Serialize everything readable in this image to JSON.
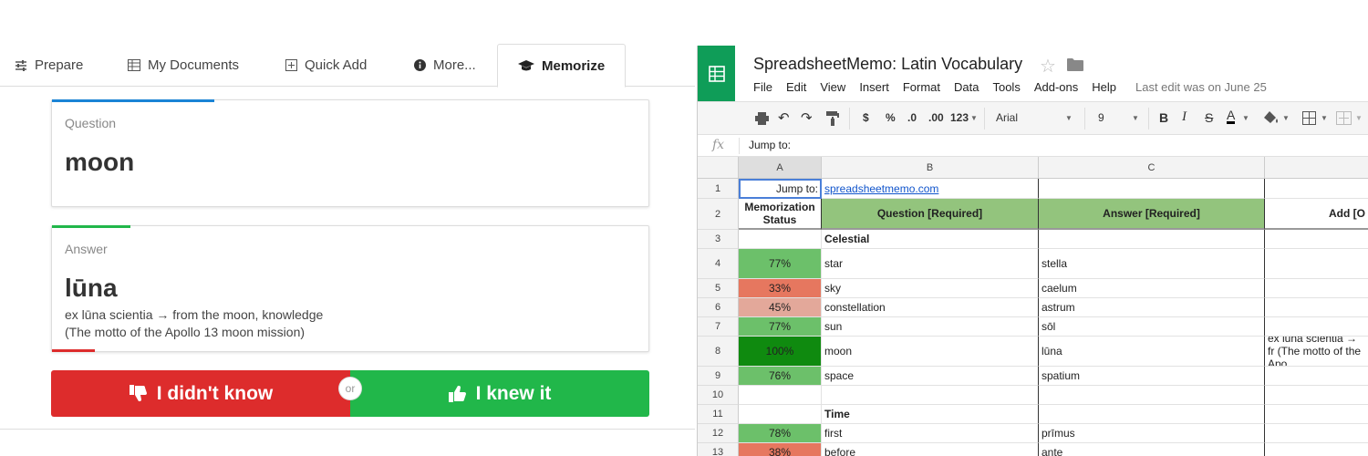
{
  "app": {
    "tabs": [
      {
        "label": "Prepare"
      },
      {
        "label": "My Documents"
      },
      {
        "label": "Quick Add"
      },
      {
        "label": "More..."
      },
      {
        "label": "Memorize"
      }
    ],
    "question": {
      "label": "Question",
      "text": "moon",
      "accent": "#1a84d6"
    },
    "answer": {
      "label": "Answer",
      "text": "lūna",
      "notes": [
        "ex lūna scientia → from the moon, knowledge",
        "(The motto of the Apollo 13 moon mission)"
      ],
      "accent": "#21b74a",
      "accent_bottom": "#dd2c2c"
    },
    "buttons": {
      "no_label": "I didn't know",
      "or_label": "or",
      "yes_label": "I knew it"
    },
    "colors": {
      "no": "#dd2c2c",
      "yes": "#21b74a"
    }
  },
  "sheet": {
    "title": "SpreadsheetMemo: Latin Vocabulary",
    "menu": [
      "File",
      "Edit",
      "View",
      "Insert",
      "Format",
      "Data",
      "Tools",
      "Add-ons",
      "Help"
    ],
    "last_edit": "Last edit was on June 25",
    "toolbar": {
      "currency": "$",
      "percent": "%",
      "dec_less": ".0",
      "dec_more": ".00",
      "format_more": "123",
      "font": "Arial",
      "size": "9"
    },
    "fx_label": "fx",
    "formula": "Jump to:",
    "columns": [
      "A",
      "B",
      "C"
    ],
    "rows": [
      {
        "n": "1",
        "a": "Jump to:",
        "b": "spreadsheetmemo.com",
        "c": "",
        "d": "",
        "color": ""
      },
      {
        "n": "2",
        "a": "Memorization Status",
        "b": "Question [Required]",
        "c": "Answer [Required]",
        "d": "Add [O",
        "color": ""
      },
      {
        "n": "3",
        "a": "",
        "b": "Celestial",
        "c": "",
        "d": "",
        "color": ""
      },
      {
        "n": "4",
        "a": "77%",
        "b": "star",
        "c": "stella",
        "d": "",
        "color": "#6cc06a"
      },
      {
        "n": "5",
        "a": "33%",
        "b": "sky",
        "c": "caelum",
        "d": "",
        "color": "#e6775f"
      },
      {
        "n": "6",
        "a": "45%",
        "b": "constellation",
        "c": "astrum",
        "d": "",
        "color": "#e3a89a"
      },
      {
        "n": "7",
        "a": "77%",
        "b": "sun",
        "c": "sōl",
        "d": "",
        "color": "#6cc06a"
      },
      {
        "n": "8",
        "a": "100%",
        "b": "moon",
        "c": "lūna",
        "d": "ex lūna scientia → fr\n(The motto of the Apo",
        "color": "#0f8a0f"
      },
      {
        "n": "9",
        "a": "76%",
        "b": "space",
        "c": "spatium",
        "d": "",
        "color": "#6cc06a"
      },
      {
        "n": "10",
        "a": "",
        "b": "",
        "c": "",
        "d": "",
        "color": ""
      },
      {
        "n": "11",
        "a": "",
        "b": "Time",
        "c": "",
        "d": "",
        "color": ""
      },
      {
        "n": "12",
        "a": "78%",
        "b": "first",
        "c": "prīmus",
        "d": "",
        "color": "#6cc06a"
      },
      {
        "n": "13",
        "a": "38%",
        "b": "before",
        "c": "ante",
        "d": "",
        "color": "#e6775f"
      }
    ],
    "header_green": "#93c47d",
    "logo_color": "#0f9d58"
  }
}
